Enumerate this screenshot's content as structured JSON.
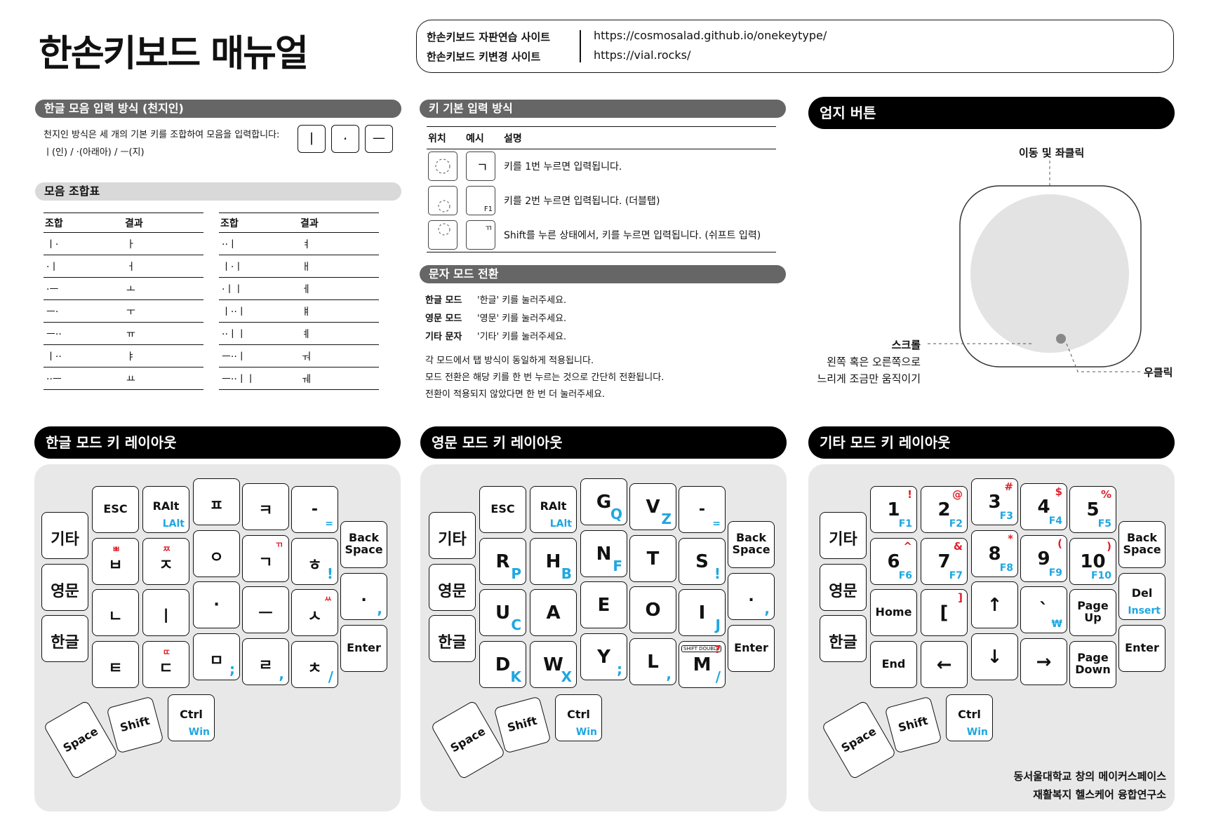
{
  "title": "한손키보드 매뉴얼",
  "links": [
    {
      "label": "한손키보드 자판연습 사이트",
      "url": "https://cosmosalad.github.io/onekeytype/"
    },
    {
      "label": "한손키보드 키변경 사이트",
      "url": "https://vial.rocks/"
    }
  ],
  "vowel": {
    "header": "한글 모음 입력 방식 (천지인)",
    "desc": "천지인 방식은 세 개의 기본 키를 조합하여 모음을 입력합니다:",
    "keys_desc": "ㅣ(인)  /  ·(아래아)  /  ㅡ(지)",
    "keys": [
      "ㅣ",
      "·",
      "ㅡ"
    ]
  },
  "combo": {
    "header": "모음 조합표",
    "col_comb": "조합",
    "col_result": "결과",
    "left": [
      [
        "ㅣ·",
        "ㅏ"
      ],
      [
        "·ㅣ",
        "ㅓ"
      ],
      [
        "·ㅡ",
        "ㅗ"
      ],
      [
        "ㅡ·",
        "ㅜ"
      ],
      [
        "ㅡ··",
        "ㅠ"
      ],
      [
        "ㅣ··",
        "ㅑ"
      ],
      [
        "··ㅡ",
        "ㅛ"
      ]
    ],
    "right": [
      [
        "··ㅣ",
        "ㅕ"
      ],
      [
        "ㅣ·ㅣ",
        "ㅐ"
      ],
      [
        "·ㅣㅣ",
        "ㅔ"
      ],
      [
        "ㅣ··ㅣ",
        "ㅒ"
      ],
      [
        "··ㅣㅣ",
        "ㅖ"
      ],
      [
        "ㅡ··ㅣ",
        "ㅝ"
      ],
      [
        "ㅡ··ㅣㅣ",
        "ㅞ"
      ]
    ]
  },
  "basic": {
    "header": "키 기본 입력 방식",
    "col_pos": "위치",
    "col_ex": "예시",
    "col_desc": "설명",
    "rows": [
      {
        "ex": "ㄱ",
        "desc": "키를 1번 누르면 입력됩니다."
      },
      {
        "ex": "F1",
        "desc": "키를 2번 누르면 입력됩니다. (더블탭)"
      },
      {
        "ex": "ㄲ",
        "desc": "Shift를 누른 상태에서, 키를 누르면 입력됩니다. (쉬프트 입력)"
      }
    ]
  },
  "mode": {
    "header": "문자 모드 전환",
    "rows": [
      {
        "name": "한글 모드",
        "desc": "'한글' 키를 눌러주세요."
      },
      {
        "name": "영문 모드",
        "desc": "'영문' 키를 눌러주세요."
      },
      {
        "name": "기타 문자",
        "desc": "'기타' 키를 눌러주세요."
      }
    ],
    "notes": [
      "각 모드에서 탭 방식이 동일하게 적용됩니다.",
      "모드 전환은 해당 키를 한 번 누르는 것으로 간단히 전환됩니다.",
      "전환이 적용되지 않았다면 한 번 더 눌러주세요."
    ]
  },
  "thumb": {
    "header": "엄지 버튼",
    "move": "이동 및 좌클릭",
    "scroll": "스크롤",
    "scroll_desc1": "왼쪽 혹은 오른쪽으로",
    "scroll_desc2": "느리게 조금만 움직이기",
    "right_click": "우클릭"
  },
  "layouts": {
    "ko_header": "한글 모드 키 레이아웃",
    "en_header": "영문 모드 키 레이아웃",
    "etc_header": "기타 모드 키 레이아웃"
  },
  "common_keys": {
    "esc": "ESC",
    "ralt": "RAlt",
    "lalt": "LAlt",
    "gita": "기타",
    "yeongmun": "영문",
    "hangeul": "한글",
    "back": "Back",
    "space": "Space",
    "enter": "Enter",
    "shift": "Shift",
    "ctrl": "Ctrl",
    "win": "Win"
  },
  "ko_keys": {
    "p": "ㅍ",
    "k": "ㅋ",
    "dash": "-",
    "eq": "=",
    "b": "ㅂ",
    "bb": "ㅃ",
    "j": "ㅈ",
    "jj": "ㅉ",
    "o": "ㅇ",
    "g": "ㄱ",
    "gg": "ㄲ",
    "h": "ㅎ",
    "excl": "!",
    "n": "ㄴ",
    "i": "ㅣ",
    "dot": "·",
    "eu": "ㅡ",
    "s": "ㅅ",
    "ss": "ㅆ",
    "period": ".",
    "comma": ",",
    "t": "ㅌ",
    "d": "ㄷ",
    "dd": "ㄸ",
    "m": "ㅁ",
    "semi": ";",
    "r": "ㄹ",
    "comma2": ",",
    "ch": "ㅊ",
    "slash": "/"
  },
  "en_keys": {
    "g": "G",
    "q": "Q",
    "v": "V",
    "z": "Z",
    "r": "R",
    "p": "P",
    "h": "H",
    "b": "B",
    "n": "N",
    "f": "F",
    "t": "T",
    "s": "S",
    "u": "U",
    "c": "C",
    "a": "A",
    "e": "E",
    "o": "O",
    "i": "I",
    "j": "J",
    "d": "D",
    "k": "K",
    "w": "W",
    "x": "X",
    "y": "Y",
    "l": "L",
    "m": "M",
    "q2": "?",
    "shiftdouble": "SHIFT DOUBLE"
  },
  "etc_keys": {
    "n1": "1",
    "f1": "F1",
    "s1": "!",
    "n2": "2",
    "f2": "F2",
    "s2": "@",
    "n3": "3",
    "f3": "F3",
    "s3": "#",
    "n4": "4",
    "f4": "F4",
    "s4": "$",
    "n5": "5",
    "f5": "F5",
    "s5": "%",
    "n6": "6",
    "f6": "F6",
    "s6": "^",
    "n7": "7",
    "f7": "F7",
    "s7": "&",
    "n8": "8",
    "f8": "F8",
    "s8": "*",
    "n9": "9",
    "f9": "F9",
    "s9": "(",
    "n10": "10",
    "f10": "F10",
    "s10": ")",
    "home": "Home",
    "lbr": "[",
    "rbr": "]",
    "up": "↑",
    "tick": "`",
    "won": "₩",
    "page": "Page",
    "pup": "Up",
    "del": "Del",
    "insert": "Insert",
    "end": "End",
    "left": "←",
    "down": "↓",
    "right": "→",
    "pdown": "Down"
  },
  "footer": [
    "동서울대학교 창의 메이커스페이스",
    "재활복지 헬스케어 융합연구소"
  ]
}
